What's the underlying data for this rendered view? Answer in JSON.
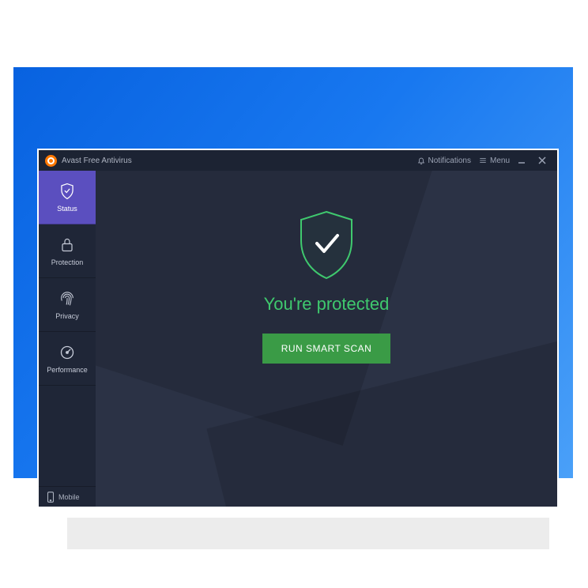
{
  "titlebar": {
    "app_title": "Avast Free Antivirus",
    "notifications": "Notifications",
    "menu": "Menu"
  },
  "sidebar": {
    "status": "Status",
    "protection": "Protection",
    "privacy": "Privacy",
    "performance": "Performance",
    "mobile": "Mobile"
  },
  "main": {
    "status_text": "You're protected",
    "scan_button": "RUN SMART SCAN"
  }
}
